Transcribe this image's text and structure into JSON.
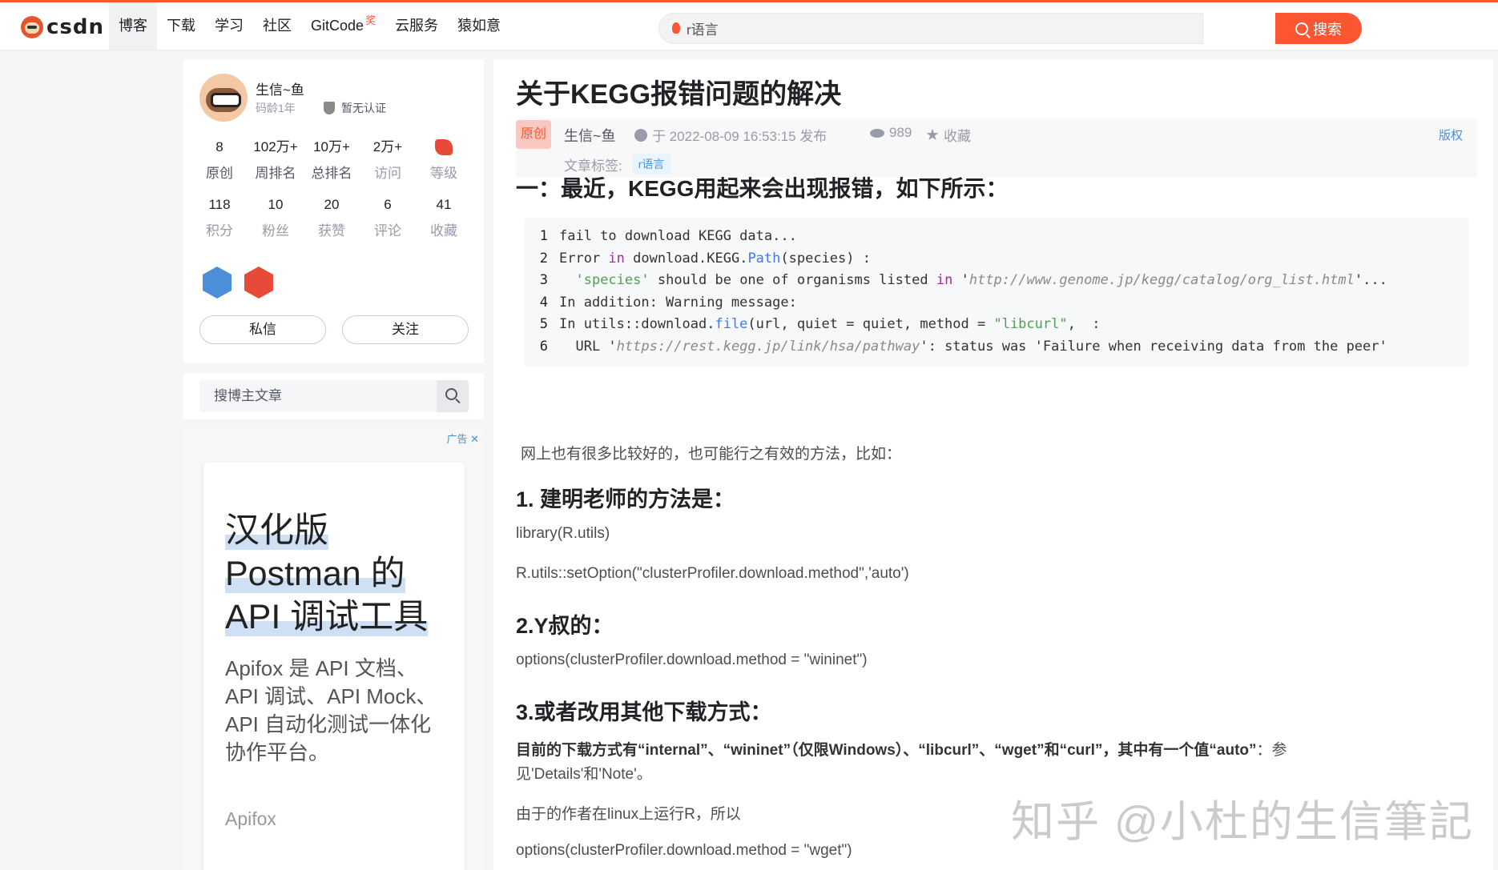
{
  "nav": {
    "logo": "csdn",
    "items": [
      {
        "label": "博客",
        "active": true
      },
      {
        "label": "下载",
        "active": false
      },
      {
        "label": "学习",
        "active": false
      },
      {
        "label": "社区",
        "active": false
      },
      {
        "label": "GitCode",
        "active": false,
        "mark": "奖"
      },
      {
        "label": "云服务",
        "active": false
      },
      {
        "label": "猿如意",
        "active": false
      }
    ],
    "search_value": "r语言",
    "search_button": "搜索"
  },
  "profile": {
    "name": "生信~鱼",
    "age": "码龄1年",
    "verify": "暂无认证",
    "stats1": [
      {
        "num": "8",
        "label": "原创"
      },
      {
        "num": "102万+",
        "label": "周排名"
      },
      {
        "num": "10万+",
        "label": "总排名"
      },
      {
        "num": "2万+",
        "label": "访问"
      },
      {
        "num": "",
        "label": "等级"
      }
    ],
    "stats2": [
      {
        "num": "118",
        "label": "积分"
      },
      {
        "num": "10",
        "label": "粉丝"
      },
      {
        "num": "20",
        "label": "获赞"
      },
      {
        "num": "6",
        "label": "评论"
      },
      {
        "num": "41",
        "label": "收藏"
      }
    ],
    "btn_message": "私信",
    "btn_follow": "关注"
  },
  "side_search": {
    "placeholder": "搜博主文章"
  },
  "ad": {
    "tag": "广告 ✕",
    "title_lines": [
      "汉化版",
      "Postman 的",
      "API 调试工具"
    ],
    "desc": "Apifox 是 API 文档、API 调试、API Mock、API 自动化测试一体化协作平台。",
    "brand": "Apifox"
  },
  "article": {
    "title": "关于KEGG报错问题的解决",
    "orig": "原创",
    "author": "生信~鱼",
    "time": "于 2022-08-09 16:53:15 发布",
    "views": "989",
    "fav": "收藏",
    "copyright": "版权",
    "tags_label": "文章标签:",
    "tag": "r语言",
    "h_main": "一：最近，KEGG用起来会出现报错，如下所示：",
    "code_lines": [
      "fail to download KEGG data...",
      "Error in download.KEGG.Path(species) :",
      "  'species' should be one of organisms listed in 'http://www.genome.jp/kegg/catalog/org_list.html'...",
      "In addition: Warning message:",
      "In utils::download.file(url, quiet = quiet, method = \"libcurl\",  :",
      "  URL 'https://rest.kegg.jp/link/hsa/pathway': status was 'Failure when receiving data from the peer'"
    ],
    "p_intro": "网上也有很多比较好的，也可能行之有效的方法，比如：",
    "h1": "1. 建明老师的方法是：",
    "p1a": "library(R.utils)",
    "p1b": "R.utils::setOption(\"clusterProfiler.download.method\",'auto')",
    "h2": "2.Y叔的：",
    "p2": "options(clusterProfiler.download.method = \"wininet\")",
    "h3": "3.或者改用其他下载方式：",
    "p3a_bold": "目前的下载方式有“internal”、“wininet”（仅限Windows）、“libcurl”、“wget”和“curl”，其中有一个值“auto”",
    "p3a_tail": "：参",
    "p3b": "见'Details'和'Note'。",
    "p4": "由于的作者在linux上运行R，所以",
    "p5": "options(clusterProfiler.download.method = \"wget\")"
  },
  "watermark": "知乎 @小杜的生信筆記"
}
